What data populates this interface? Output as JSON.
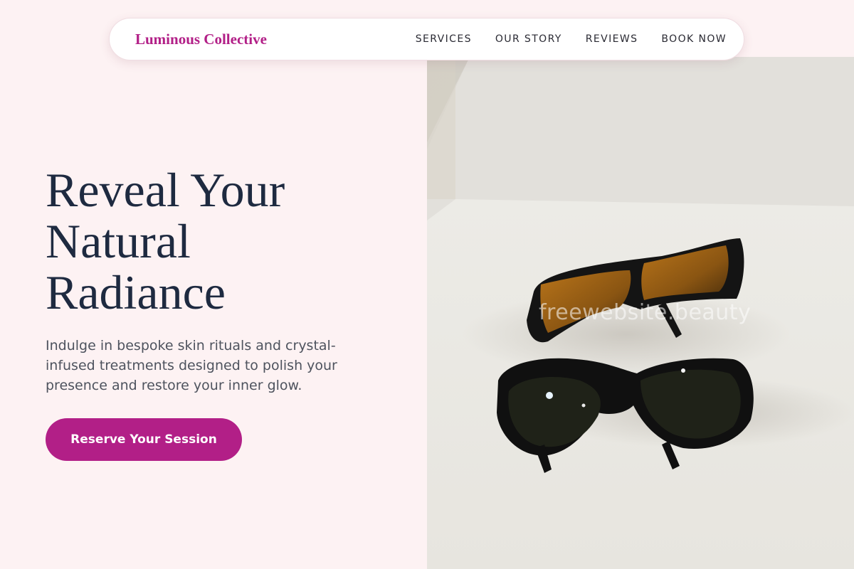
{
  "nav": {
    "brand": "Luminous Collective",
    "links": [
      {
        "label": "SERVICES"
      },
      {
        "label": "OUR STORY"
      },
      {
        "label": "REVIEWS"
      },
      {
        "label": "BOOK NOW"
      }
    ]
  },
  "hero": {
    "headline_lines": [
      "Reveal Your",
      "Natural",
      "Radiance"
    ],
    "subtext": "Indulge in bespoke skin rituals and crystal-infused treatments designed to polish your presence and restore your inner glow.",
    "cta_label": "Reserve Your Session",
    "watermark": "freewebsite.beauty"
  },
  "colors": {
    "accent": "#b21f87",
    "page_background": "#fdf2f3",
    "headline": "#1e2a40",
    "body_text": "#4e535e"
  }
}
